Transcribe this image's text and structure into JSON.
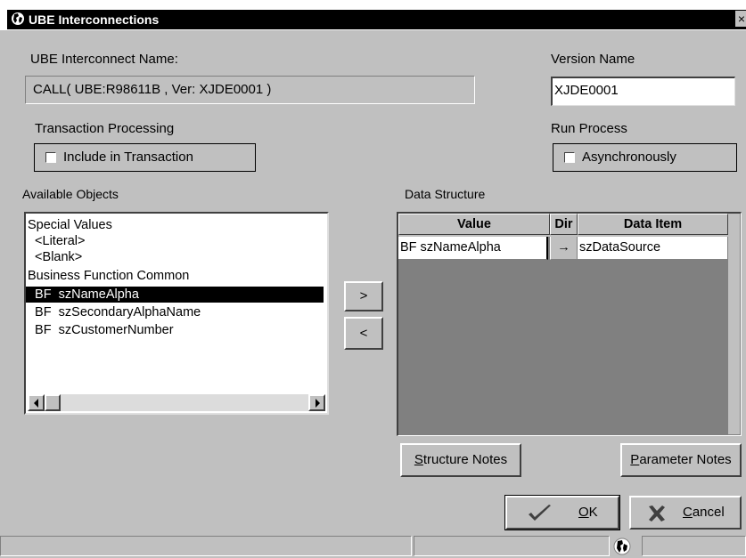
{
  "window": {
    "title": "UBE Interconnections",
    "close_glyph": "×"
  },
  "interconnect": {
    "label": "UBE Interconnect Name:",
    "value": "CALL( UBE:R98611B , Ver: XJDE0001 )"
  },
  "version": {
    "label": "Version Name",
    "value": "XJDE0001"
  },
  "transaction": {
    "label": "Transaction Processing",
    "checkbox_label": "Include in Transaction",
    "checked": false
  },
  "run_process": {
    "label": "Run Process",
    "checkbox_label": "Asynchronously",
    "checked": false
  },
  "available_objects": {
    "label": "Available Objects",
    "items": [
      {
        "text": "Special Values",
        "selected": false
      },
      {
        "text": "  <Literal>",
        "selected": false
      },
      {
        "text": "  <Blank>",
        "selected": false
      },
      {
        "text": "Business Function Common",
        "selected": false
      },
      {
        "text": "  BF  szNameAlpha",
        "selected": true
      },
      {
        "text": "  BF  szSecondaryAlphaName",
        "selected": false
      },
      {
        "text": "  BF  szCustomerNumber",
        "selected": false
      }
    ]
  },
  "move_buttons": {
    "add": ">",
    "remove": "<"
  },
  "data_structure": {
    "label": "Data Structure",
    "columns": [
      "Value",
      "Dir",
      "Data Item"
    ],
    "rows": [
      {
        "value": "BF szNameAlpha",
        "dir": "→",
        "data_item": "szDataSource"
      }
    ]
  },
  "buttons": {
    "structure_notes": {
      "mnemonic": "S",
      "rest": "tructure Notes"
    },
    "parameter_notes": {
      "mnemonic": "P",
      "rest": "arameter Notes"
    },
    "ok": {
      "mnemonic": "O",
      "rest": "K"
    },
    "cancel": {
      "mnemonic": "C",
      "rest": "ancel"
    }
  },
  "colors": {
    "title_bar": "#000000",
    "dialog_bg": "#c0c0c0",
    "selection": "#000000",
    "grid_empty": "#808080"
  }
}
